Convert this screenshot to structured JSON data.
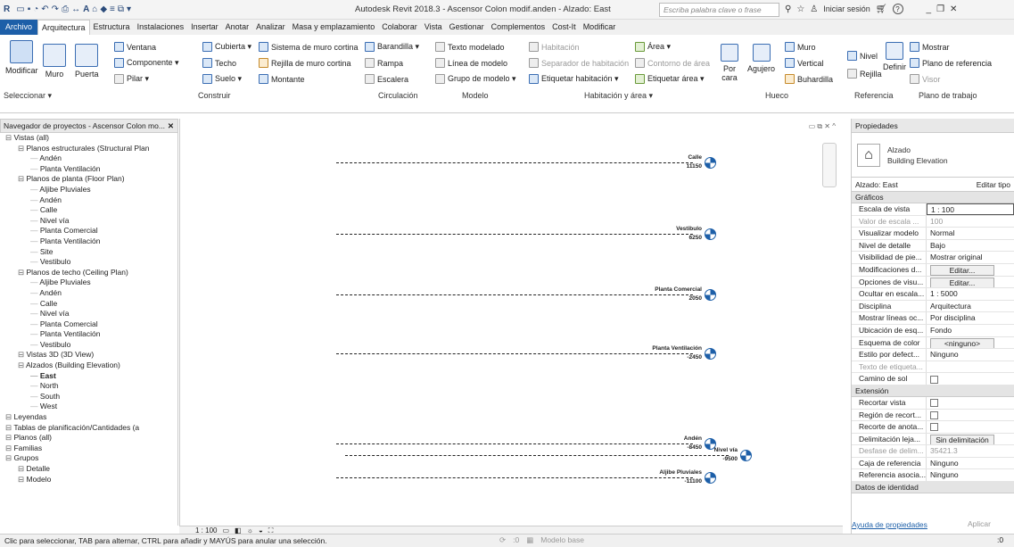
{
  "title_bar": {
    "app_title": "Autodesk Revit 2018.3 -   Ascensor Colon modif.anden - Alzado: East",
    "search_placeholder": "Escriba palabra clave o frase",
    "signin": "Iniciar sesión",
    "help": "?"
  },
  "menu": [
    "Archivo",
    "Arquitectura",
    "Estructura",
    "Instalaciones",
    "Insertar",
    "Anotar",
    "Analizar",
    "Masa y emplazamiento",
    "Colaborar",
    "Vista",
    "Gestionar",
    "Complementos",
    "Cost-It",
    "Modificar"
  ],
  "ribbon": {
    "modificar": "Modificar",
    "seleccionar": "Seleccionar ▾",
    "muro": "Muro",
    "puerta": "Puerta",
    "ventana": "Ventana",
    "componente": "Componente ▾",
    "pilar": "Pilar ▾",
    "cubierta": "Cubierta ▾",
    "techo": "Techo",
    "suelo": "Suelo ▾",
    "sistema_muro": "Sistema de muro cortina",
    "rejilla_muro": "Rejilla de muro cortina",
    "montante": "Montante",
    "barandilla": "Barandilla ▾",
    "rampa": "Rampa",
    "escalera": "Escalera",
    "texto_modelado": "Texto modelado",
    "linea_modelo": "Línea de modelo",
    "grupo_modelo": "Grupo de modelo ▾",
    "habitacion": "Habitación",
    "separador": "Separador de habitación",
    "etiquetar_hab": "Etiquetar habitación ▾",
    "area": "Área ▾",
    "contorno_area": "Contorno de área",
    "etiquetar_area": "Etiquetar área ▾",
    "por_cara": "Por cara",
    "agujero": "Agujero",
    "muro_h": "Muro",
    "vertical": "Vertical",
    "buhardilla": "Buhardilla",
    "nivel": "Nivel",
    "rejilla": "Rejilla",
    "definir": "Definir",
    "mostrar": "Mostrar",
    "plano_ref": "Plano de referencia",
    "visor": "Visor",
    "panels": [
      "Construir",
      "Circulación",
      "Modelo",
      "Habitación y área ▾",
      "Hueco",
      "Referencia",
      "Plano de trabajo"
    ]
  },
  "project_browser": {
    "header": "Navegador de proyectos - Ascensor Colon mo...",
    "items": [
      {
        "label": "Vistas (all)",
        "depth": 0,
        "bold": false
      },
      {
        "label": "Planos estructurales (Structural Plan",
        "depth": 1,
        "bold": false
      },
      {
        "label": "Andén",
        "depth": 2,
        "bold": false
      },
      {
        "label": "Planta Ventilación",
        "depth": 2,
        "bold": false
      },
      {
        "label": "Planos de planta (Floor Plan)",
        "depth": 1,
        "bold": false
      },
      {
        "label": "Aljibe Pluviales",
        "depth": 2,
        "bold": false
      },
      {
        "label": "Andén",
        "depth": 2,
        "bold": false
      },
      {
        "label": "Calle",
        "depth": 2,
        "bold": false
      },
      {
        "label": "Nivel vía",
        "depth": 2,
        "bold": false
      },
      {
        "label": "Planta Comercial",
        "depth": 2,
        "bold": false
      },
      {
        "label": "Planta Ventilación",
        "depth": 2,
        "bold": false
      },
      {
        "label": "Site",
        "depth": 2,
        "bold": false
      },
      {
        "label": "Vestibulo",
        "depth": 2,
        "bold": false
      },
      {
        "label": "Planos de techo (Ceiling Plan)",
        "depth": 1,
        "bold": false
      },
      {
        "label": "Aljibe Pluviales",
        "depth": 2,
        "bold": false
      },
      {
        "label": "Andén",
        "depth": 2,
        "bold": false
      },
      {
        "label": "Calle",
        "depth": 2,
        "bold": false
      },
      {
        "label": "Nivel vía",
        "depth": 2,
        "bold": false
      },
      {
        "label": "Planta Comercial",
        "depth": 2,
        "bold": false
      },
      {
        "label": "Planta Ventilación",
        "depth": 2,
        "bold": false
      },
      {
        "label": "Vestibulo",
        "depth": 2,
        "bold": false
      },
      {
        "label": "Vistas 3D (3D View)",
        "depth": 1,
        "bold": false
      },
      {
        "label": "Alzados (Building Elevation)",
        "depth": 1,
        "bold": false
      },
      {
        "label": "East",
        "depth": 2,
        "bold": true
      },
      {
        "label": "North",
        "depth": 2,
        "bold": false
      },
      {
        "label": "South",
        "depth": 2,
        "bold": false
      },
      {
        "label": "West",
        "depth": 2,
        "bold": false
      },
      {
        "label": "Leyendas",
        "depth": 0,
        "bold": false
      },
      {
        "label": "Tablas de planificación/Cantidades (a",
        "depth": 0,
        "bold": false
      },
      {
        "label": "Planos (all)",
        "depth": 0,
        "bold": false
      },
      {
        "label": "Familias",
        "depth": 0,
        "bold": false
      },
      {
        "label": "Grupos",
        "depth": 0,
        "bold": false
      },
      {
        "label": "Detalle",
        "depth": 1,
        "bold": false
      },
      {
        "label": "Modelo",
        "depth": 1,
        "bold": false
      }
    ]
  },
  "levels": [
    {
      "name": "Calle",
      "value": "11150"
    },
    {
      "name": "Vestibulo",
      "value": "6250"
    },
    {
      "name": "Planta Comercial",
      "value": "2050"
    },
    {
      "name": "Planta Ventilación",
      "value": "-2450"
    },
    {
      "name": "Andén",
      "value": "-8450"
    },
    {
      "name": "Nivel vía",
      "value": "-9500"
    },
    {
      "name": "Aljibe Pluviales",
      "value": "-11100"
    }
  ],
  "properties": {
    "header": "Propiedades",
    "type_line1": "Alzado",
    "type_line2": "Building Elevation",
    "selector": "Alzado: East",
    "edit_type": "Editar tipo",
    "sections": {
      "graficos": "Gráficos",
      "extension": "Extensión",
      "identidad": "Datos de identidad"
    },
    "graficos_rows": [
      {
        "k": "Escala de vista",
        "v": "1 : 100"
      },
      {
        "k": "Valor de escala ...",
        "v": "100"
      },
      {
        "k": "Visualizar modelo",
        "v": "Normal"
      },
      {
        "k": "Nivel de detalle",
        "v": "Bajo"
      },
      {
        "k": "Visibilidad de pie...",
        "v": "Mostrar original"
      },
      {
        "k": "Modificaciones d...",
        "v": "Editar..."
      },
      {
        "k": "Opciones de visu...",
        "v": "Editar..."
      },
      {
        "k": "Ocultar en escala...",
        "v": "1 : 5000"
      },
      {
        "k": "Disciplina",
        "v": "Arquitectura"
      },
      {
        "k": "Mostrar líneas oc...",
        "v": "Por disciplina"
      },
      {
        "k": "Ubicación de esq...",
        "v": "Fondo"
      },
      {
        "k": "Esquema de color",
        "v": "<ninguno>"
      },
      {
        "k": "Estilo por defect...",
        "v": "Ninguno"
      },
      {
        "k": "Texto de etiqueta...",
        "v": ""
      },
      {
        "k": "Camino de sol",
        "v": ""
      }
    ],
    "extension_rows": [
      {
        "k": "Recortar vista",
        "v": ""
      },
      {
        "k": "Región de recort...",
        "v": ""
      },
      {
        "k": "Recorte de anota...",
        "v": ""
      },
      {
        "k": "Delimitación leja...",
        "v": "Sin delimitación"
      },
      {
        "k": "Desfase de delim...",
        "v": "35421.3"
      },
      {
        "k": "Caja de referencia",
        "v": "Ninguno"
      },
      {
        "k": "Referencia asocia...",
        "v": "Ninguno"
      }
    ],
    "help": "Ayuda de propiedades",
    "apply": "Aplicar"
  },
  "view_control": {
    "scale": "1 : 100"
  },
  "status": {
    "text": "Clic para seleccionar, TAB para alternar, CTRL para añadir y MAYÚS para anular una selección.",
    "zero": ":0",
    "model": "Modelo base",
    "filter": ":0"
  }
}
